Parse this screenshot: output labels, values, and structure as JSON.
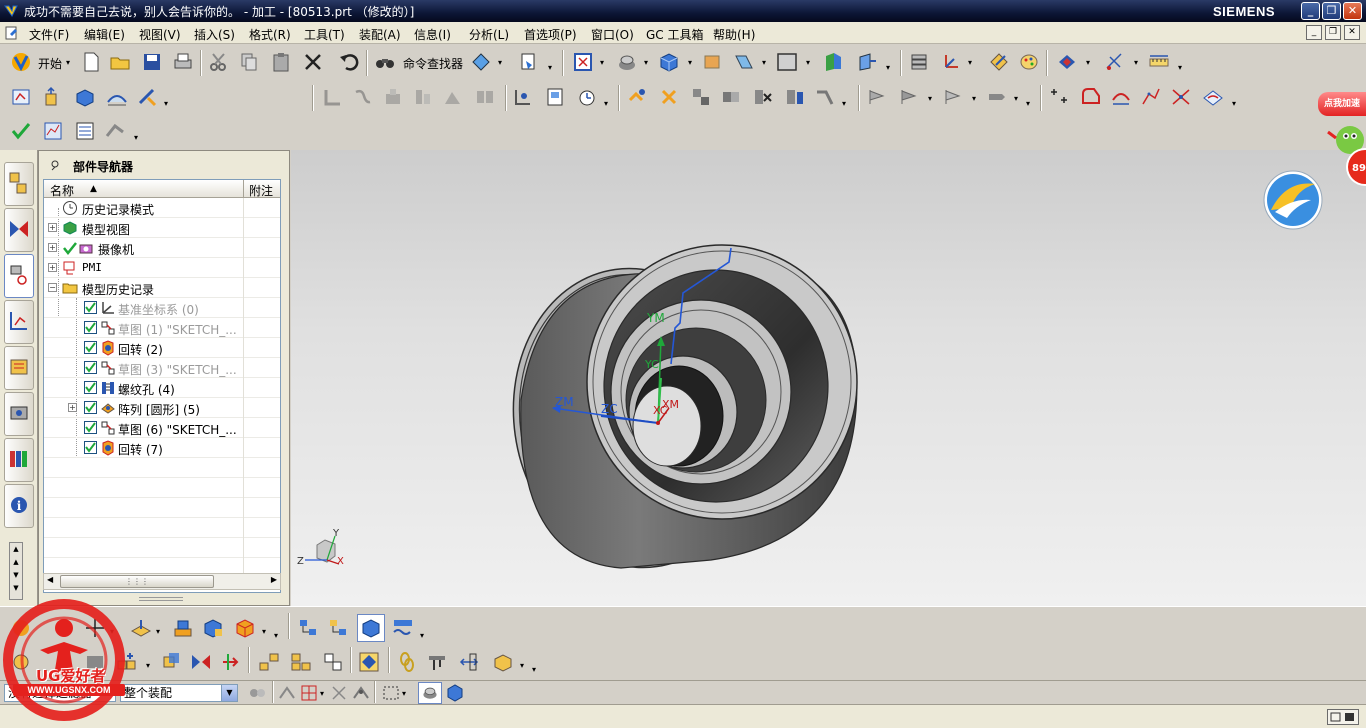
{
  "window": {
    "title": "成功不需要自己去说，别人会告诉你的。 - 加工 - [80513.prt （修改的）]",
    "brand": "SIEMENS",
    "buttons": [
      "_",
      "❐",
      "✕"
    ]
  },
  "menubar": {
    "items": [
      "文件(F)",
      "编辑(E)",
      "视图(V)",
      "插入(S)",
      "格式(R)",
      "工具(T)",
      "装配(A)",
      "信息(I)",
      "分析(L)",
      "首选项(P)",
      "窗口(O)",
      "GC 工具箱",
      "帮助(H)"
    ]
  },
  "toolbar": {
    "start_label": "开始",
    "command_finder_label": "命令查找器"
  },
  "navigator": {
    "title": "部件导航器",
    "columns": [
      "名称",
      "附注"
    ],
    "rows": [
      {
        "label": "历史记录模式",
        "icon": "clock-icon",
        "dim": false
      },
      {
        "label": "模型视图",
        "icon": "model-view-icon",
        "dim": false
      },
      {
        "label": "摄像机",
        "icon": "camera-icon",
        "dim": false
      },
      {
        "label": "PMI",
        "icon": "pmi-icon",
        "dim": false
      },
      {
        "label": "模型历史记录",
        "icon": "folder-icon",
        "dim": false
      },
      {
        "label": "基准坐标系 (0)",
        "icon": "datum-csys-icon",
        "dim": true
      },
      {
        "label": "草图 (1) \"SKETCH_...",
        "icon": "sketch-icon",
        "dim": true
      },
      {
        "label": "回转 (2)",
        "icon": "revolve-icon",
        "dim": false
      },
      {
        "label": "草图 (3) \"SKETCH_...",
        "icon": "sketch-icon",
        "dim": true
      },
      {
        "label": "螺纹孔 (4)",
        "icon": "threaded-hole-icon",
        "dim": false
      },
      {
        "label": "阵列 [圆形] (5)",
        "icon": "pattern-icon",
        "dim": false
      },
      {
        "label": "草图 (6) \"SKETCH_...",
        "icon": "sketch-icon",
        "dim": false
      },
      {
        "label": "回转 (7)",
        "icon": "revolve-icon",
        "dim": false
      }
    ]
  },
  "viewport": {
    "axis_labels": {
      "ym": "YM",
      "yc": "YC",
      "zm": "ZM",
      "zc": "ZC",
      "xc": "XC",
      "xm": "XM"
    },
    "triad_labels": {
      "y": "Y",
      "z": "Z",
      "x": "X"
    }
  },
  "selection_bar": {
    "filter_value": "没有选择过滤器",
    "scope_value": "整个装配"
  },
  "overlays": {
    "ad_button": "点我加速",
    "ad_badge": "89",
    "watermark_text": "UG爱好者",
    "watermark_url": "WWW.UGSNX.COM"
  },
  "colors": {
    "title_bar": "#0c1636",
    "chrome": "#d4d0c8",
    "model_gray": "#6e6e6e",
    "axis_green": "#1fa83a",
    "axis_blue": "#2457d6",
    "axis_red": "#c01818"
  }
}
